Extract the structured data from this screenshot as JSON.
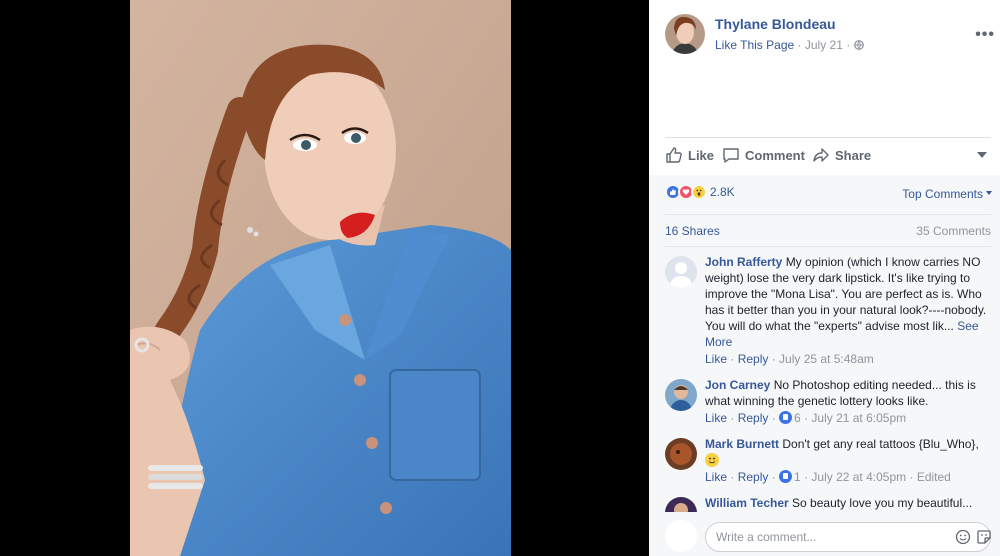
{
  "post": {
    "page_name": "Thylane Blondeau",
    "like_page": "Like This Page",
    "date": "July 21",
    "menu": "•••"
  },
  "actions": {
    "like": "Like",
    "comment": "Comment",
    "share": "Share"
  },
  "reactions": {
    "count": "2.8K",
    "types": [
      "like-icon",
      "love-icon",
      "wow-icon"
    ]
  },
  "sort": "Top Comments",
  "shares": "16 Shares",
  "comments_count": "35 Comments",
  "comments": [
    {
      "author": "John Rafferty",
      "text": "My opinion (which I know carries NO weight) lose the very dark lipstick. It's like trying to improve the \"Mona Lisa\". You are perfect as is. Who has it better than you in your natural look?----nobody. You will do what the \"experts\" advise most lik...",
      "see_more": "See More",
      "like": "Like",
      "reply": "Reply",
      "time": "July 25 at 5:48am"
    },
    {
      "author": "Jon Carney",
      "text": "No Photoshop editing needed... this is what winning the genetic lottery looks like.",
      "like": "Like",
      "reply": "Reply",
      "likes": "6",
      "time": "July 21 at 6:05pm"
    },
    {
      "author": "Mark Burnett",
      "text": "Don't get any real tattoos {Blu_Who},",
      "like": "Like",
      "reply": "Reply",
      "likes": "1",
      "time": "July 22 at 4:05pm",
      "edited": "Edited"
    },
    {
      "author": "William Techer",
      "text": "So beauty love you my beautiful..."
    }
  ],
  "composer": {
    "placeholder": "Write a comment..."
  },
  "colors": {
    "link": "#365899",
    "muted": "#90949c",
    "like_blue": "#3b72e6",
    "love_red": "#f25268",
    "wow_yellow": "#f7d044"
  }
}
